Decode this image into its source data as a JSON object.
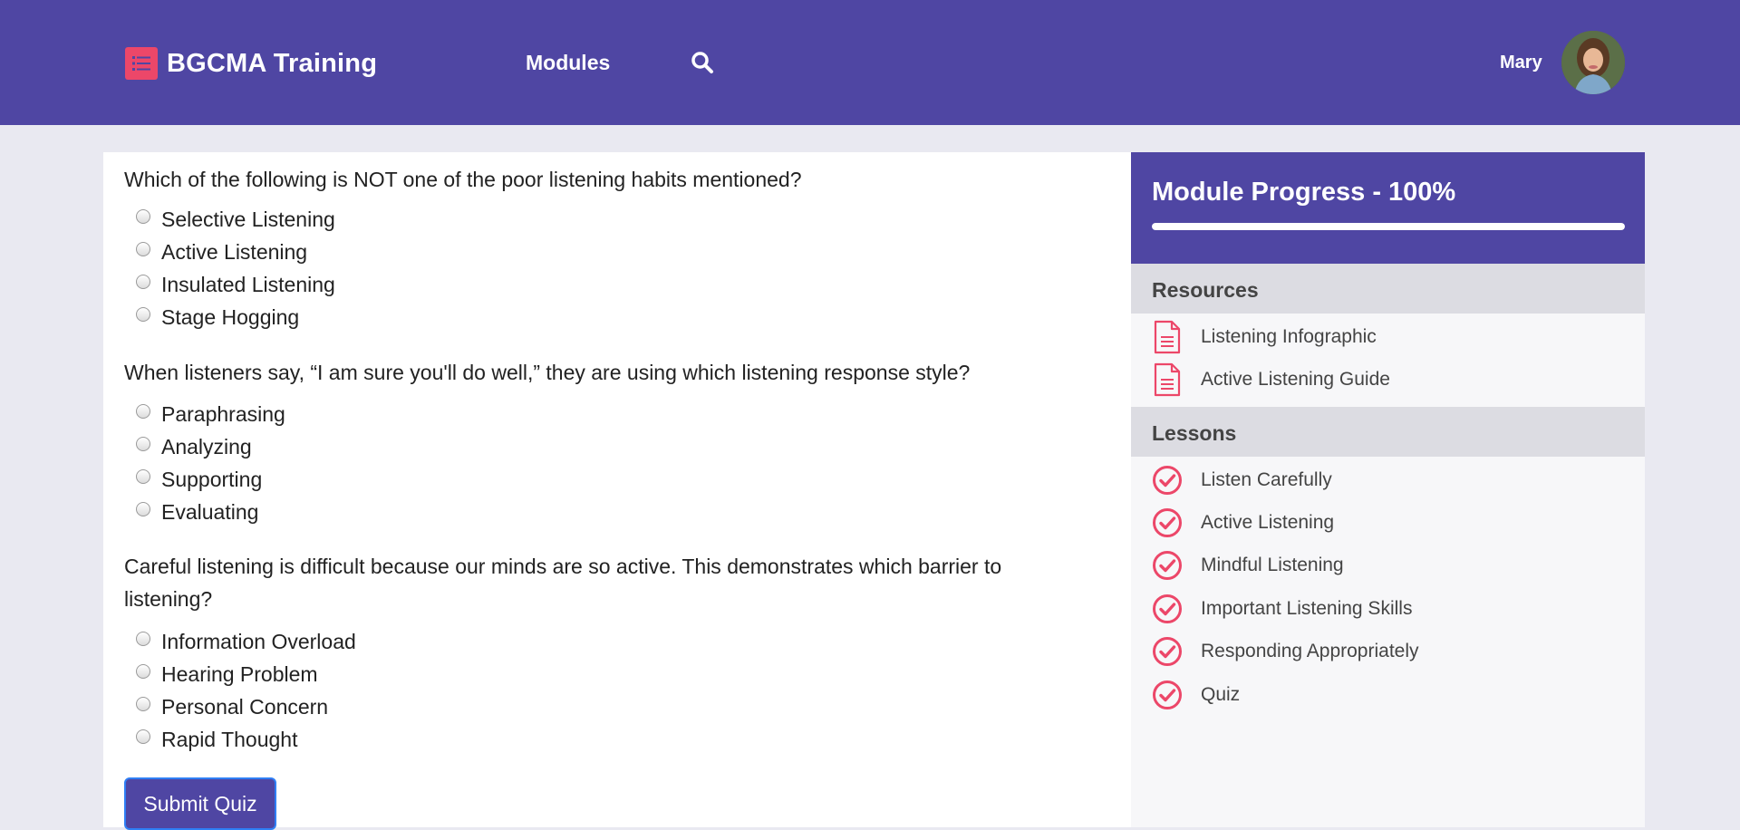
{
  "header": {
    "brand": "BGCMA Training",
    "nav_modules": "Modules",
    "user_name": "Mary"
  },
  "quiz": {
    "questions": [
      {
        "text": "Which of the following is NOT one of the poor listening habits mentioned?",
        "options": [
          "Selective Listening",
          "Active Listening",
          "Insulated Listening",
          "Stage Hogging"
        ]
      },
      {
        "text": "When listeners say, “I am sure you'll do well,” they are using which listening response style?",
        "options": [
          "Paraphrasing",
          "Analyzing",
          "Supporting",
          "Evaluating"
        ]
      },
      {
        "text": "Careful listening is difficult because our minds are so active. This demonstrates which barrier to listening?",
        "options": [
          "Information Overload",
          "Hearing Problem",
          "Personal Concern",
          "Rapid Thought"
        ]
      }
    ],
    "submit_label": "Submit Quiz"
  },
  "sidebar": {
    "progress_title": "Module Progress - 100%",
    "progress_percent": 100,
    "resources_title": "Resources",
    "resources": [
      "Listening Infographic",
      "Active Listening Guide"
    ],
    "lessons_title": "Lessons",
    "lessons": [
      "Listen Carefully",
      "Active Listening",
      "Mindful Listening",
      "Important Listening Skills",
      "Responding Appropriately",
      "Quiz"
    ]
  },
  "colors": {
    "primary": "#4f46a3",
    "accent": "#ec4769",
    "page_bg": "#e9e9f1"
  },
  "icons": {
    "brand": "list-icon",
    "search": "search-icon",
    "resource": "document-icon",
    "lesson": "check-circle-icon"
  }
}
